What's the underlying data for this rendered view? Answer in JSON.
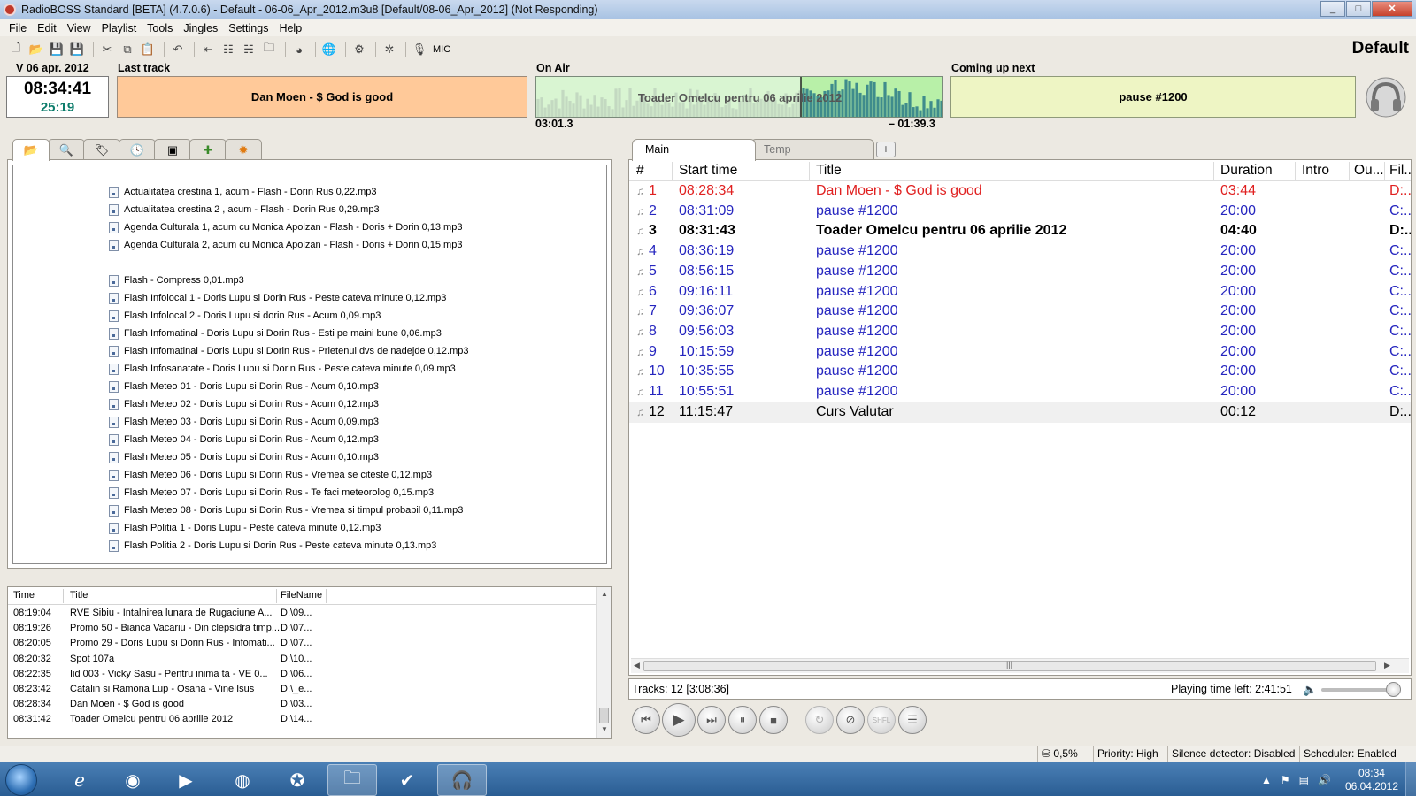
{
  "window": {
    "title": "RadioBOSS Standard [BETA] (4.7.0.6) - Default - 06-06_Apr_2012.m3u8 [Default/08-06_Apr_2012] (Not Responding)",
    "controls": [
      "_",
      "□",
      "✕"
    ]
  },
  "menu": [
    "File",
    "Edit",
    "View",
    "Playlist",
    "Tools",
    "Jingles",
    "Settings",
    "Help"
  ],
  "toolbar": {
    "icons": [
      "new-file-icon",
      "open-folder-icon",
      "save-icon",
      "save-as-icon",
      "cut-icon",
      "copy-icon",
      "paste-icon",
      "undo-icon",
      "insert-track-icon",
      "insert-list-icon",
      "insert-multi-icon",
      "insert-folder-icon",
      "stream-icon",
      "internet-icon",
      "settings-gear-icon",
      "scheduler-icon",
      "mic-icon"
    ],
    "mic_label": "MIC"
  },
  "profile": "Default",
  "header": {
    "date": "V 06 apr. 2012",
    "clock_time": "08:34:41",
    "clock_remain": "25:19",
    "last_track_label": "Last track",
    "last_track": "Dan Moen -  $ God is good",
    "on_air_label": "On Air",
    "on_air": "Toader Omelcu pentru 06 aprilie 2012",
    "on_air_elapsed": "03:01.3",
    "on_air_remaining": "– 01:39.3",
    "on_air_progress": 0.65,
    "next_label": "Coming up next",
    "next": "pause #1200"
  },
  "colors": {
    "last_track_bg": "#ffc999",
    "on_air_bg": "#d9f5d2",
    "next_bg": "#eef5c4",
    "played": "#e02020",
    "queued": "#2525bf"
  },
  "left_tabs": [
    "folder-icon",
    "search-icon",
    "tag-icon",
    "clock-icon",
    "film-icon",
    "puzzle-icon",
    "jingle-icon"
  ],
  "browser": {
    "files": [
      "Actualitatea crestina 1, acum - Flash - Dorin Rus    0,22.mp3",
      "Actualitatea crestina 2 , acum - Flash - Dorin Rus    0,29.mp3",
      "Agenda Culturala 1, acum cu Monica Apolzan - Flash - Doris + Dorin    0,13.mp3",
      "Agenda Culturala 2, acum cu Monica Apolzan - Flash - Doris + Dorin    0,15.mp3",
      "",
      "Flash -  Compress        0,01.mp3",
      "Flash Infolocal 1 - Doris Lupu si Dorin Rus - Peste cateva minute     0,12.mp3",
      "Flash Infolocal 2 - Doris Lupu si dorin Rus - Acum     0,09.mp3",
      "Flash Infomatinal - Doris Lupu si Dorin Rus - Esti pe maini bune      0,06.mp3",
      "Flash Infomatinal - Doris Lupu si Dorin Rus - Prietenul dvs de nadejde       0,12.mp3",
      "Flash Infosanatate - Doris Lupu si Dorin Rus  - Peste cateva minute      0,09.mp3",
      "Flash Meteo 01 - Doris Lupu si Dorin Rus  - Acum     0,10.mp3",
      "Flash Meteo 02 - Doris Lupu si Dorin Rus  - Acum     0,12.mp3",
      "Flash Meteo 03 - Doris Lupu si Dorin Rus  - Acum     0,09.mp3",
      "Flash Meteo 04 - Doris Lupu si Dorin Rus  - Acum     0,12.mp3",
      "Flash Meteo 05 - Doris Lupu si Dorin Rus  - Acum     0,10.mp3",
      "Flash Meteo 06 - Doris Lupu si Dorin Rus  - Vremea se citeste      0,12.mp3",
      "Flash Meteo 07 - Doris Lupu si Dorin Rus  - Te faci meteorolog      0,15.mp3",
      "Flash Meteo 08 - Doris Lupu si Dorin Rus  - Vremea si timpul probabil      0,11.mp3",
      "Flash Politia 1 - Doris Lupu - Peste cateva minute        0,12.mp3",
      "Flash Politia 2 - Doris Lupu si Dorin Rus - Peste cateva minute        0,13.mp3"
    ]
  },
  "history": {
    "columns": [
      "Time",
      "Title",
      "FileName"
    ],
    "rows": [
      [
        "08:19:04",
        "RVE Sibiu -  Intalnirea lunara de Rugaciune A...",
        "D:\\09..."
      ],
      [
        "08:19:26",
        "Promo 50 - Bianca Vacariu - Din clepsidra timp...",
        "D:\\07..."
      ],
      [
        "08:20:05",
        "Promo 29 - Doris Lupu si Dorin Rus - Infomati...",
        "D:\\07..."
      ],
      [
        "08:20:32",
        "Spot 107a",
        "D:\\10..."
      ],
      [
        "08:22:35",
        "Iid 003 - Vicky Sasu - Pentru inima ta - VE      0...",
        "D:\\06..."
      ],
      [
        "08:23:42",
        "Catalin si Ramona Lup -  Osana - Vine Isus",
        "D:\\_e..."
      ],
      [
        "08:28:34",
        "Dan Moen -  $ God is good",
        "D:\\03..."
      ],
      [
        "08:31:42",
        "Toader Omelcu pentru 06 aprilie 2012",
        "D:\\14..."
      ]
    ]
  },
  "playlist": {
    "tabs": [
      "Main",
      "Temp"
    ],
    "add_tab": "+",
    "columns": [
      "#",
      "Start time",
      "Title",
      "Duration",
      "Intro",
      "Ou...",
      "Fil..."
    ],
    "rows": [
      {
        "n": "1",
        "start": "08:28:34",
        "title": "Dan Moen -  $ God is good",
        "dur": "03:44",
        "file": "D:...",
        "state": "played"
      },
      {
        "n": "2",
        "start": "08:31:09",
        "title": "pause #1200",
        "dur": "20:00",
        "file": "C:...",
        "state": "queued"
      },
      {
        "n": "3",
        "start": "08:31:43",
        "title": "Toader Omelcu pentru 06 aprilie 2012",
        "dur": "04:40",
        "file": "D:...",
        "state": "playing"
      },
      {
        "n": "4",
        "start": "08:36:19",
        "title": "pause #1200",
        "dur": "20:00",
        "file": "C:...",
        "state": "queued"
      },
      {
        "n": "5",
        "start": "08:56:15",
        "title": "pause #1200",
        "dur": "20:00",
        "file": "C:...",
        "state": "queued"
      },
      {
        "n": "6",
        "start": "09:16:11",
        "title": "pause #1200",
        "dur": "20:00",
        "file": "C:...",
        "state": "queued"
      },
      {
        "n": "7",
        "start": "09:36:07",
        "title": "pause #1200",
        "dur": "20:00",
        "file": "C:...",
        "state": "queued"
      },
      {
        "n": "8",
        "start": "09:56:03",
        "title": "pause #1200",
        "dur": "20:00",
        "file": "C:...",
        "state": "queued"
      },
      {
        "n": "9",
        "start": "10:15:59",
        "title": "pause #1200",
        "dur": "20:00",
        "file": "C:...",
        "state": "queued"
      },
      {
        "n": "10",
        "start": "10:35:55",
        "title": "pause #1200",
        "dur": "20:00",
        "file": "C:...",
        "state": "queued"
      },
      {
        "n": "11",
        "start": "10:55:51",
        "title": "pause #1200",
        "dur": "20:00",
        "file": "C:...",
        "state": "queued"
      },
      {
        "n": "12",
        "start": "11:15:47",
        "title": "Curs Valutar",
        "dur": "00:12",
        "file": "D:...",
        "state": "normal"
      }
    ],
    "tracks_summary": "Tracks: 12 [3:08:36]",
    "playing_time_left": "Playing time left: 2:41:51",
    "volume": 0.9
  },
  "transport": [
    "previous-icon",
    "play-icon",
    "next-icon",
    "pause-icon",
    "stop-icon",
    "loop-icon",
    "cancel-icon",
    "shuffle-icon",
    "playlist-icon"
  ],
  "transport_glyphs": [
    "⏮",
    "▶",
    "⏭",
    "⏸",
    "■",
    "↻",
    "⊘",
    "SHFL",
    "☰"
  ],
  "statusbar": {
    "cpu": "0,5%",
    "priority": "Priority: High",
    "silence": "Silence detector: Disabled",
    "scheduler": "Scheduler: Enabled"
  },
  "taskbar": {
    "apps": [
      "ie-icon",
      "media-center-icon",
      "media-player-icon",
      "firefox-icon",
      "safari-icon",
      "explorer-icon",
      "tasks-icon",
      "radioboss-icon"
    ],
    "clock_time": "08:34",
    "clock_date": "06.04.2012"
  }
}
